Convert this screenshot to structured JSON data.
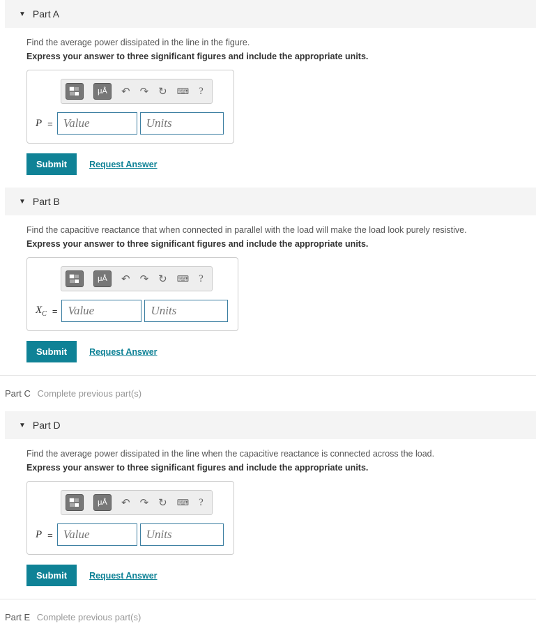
{
  "toolbar": {
    "ua_label": "μÅ",
    "help_label": "?"
  },
  "common": {
    "submit_label": "Submit",
    "request_label": "Request Answer",
    "value_placeholder": "Value",
    "units_placeholder": "Units",
    "instruction": "Express your answer to three significant figures and include the appropriate units."
  },
  "partA": {
    "title": "Part A",
    "prompt": "Find the average power dissipated in the line in the figure.",
    "var": "P",
    "eq": "="
  },
  "partB": {
    "title": "Part B",
    "prompt": "Find the capacitive reactance that when connected in parallel with the load will make the load look purely resistive.",
    "var": "X",
    "varsub": "C",
    "eq": "="
  },
  "partC": {
    "title": "Part C",
    "msg": "Complete previous part(s)"
  },
  "partD": {
    "title": "Part D",
    "prompt": "Find the average power dissipated in the line when the capacitive reactance is connected across the load.",
    "var": "P",
    "eq": "="
  },
  "partE": {
    "title": "Part E",
    "msg": "Complete previous part(s)"
  }
}
